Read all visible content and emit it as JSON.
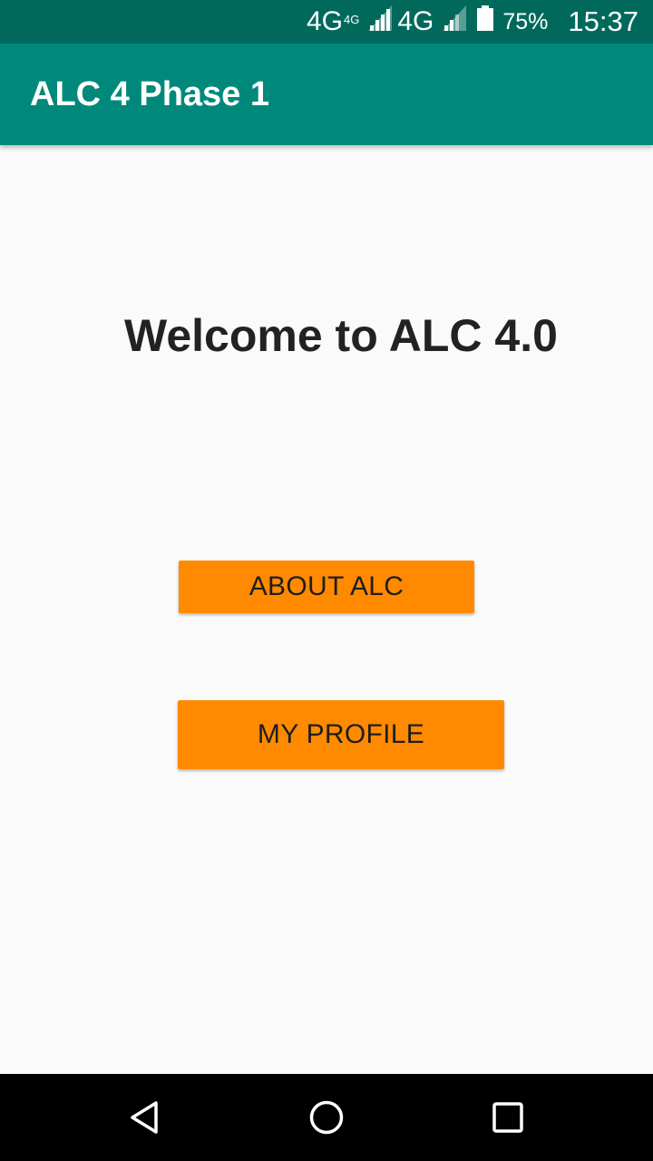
{
  "status_bar": {
    "network_1": "4G",
    "network_1_sup": "4G",
    "network_2": "4G",
    "battery_percent": "75%",
    "time": "15:37",
    "icons": [
      "signal-icon",
      "signal-icon",
      "battery-icon"
    ]
  },
  "app_bar": {
    "title": "ALC 4 Phase 1"
  },
  "main": {
    "welcome_text": "Welcome to ALC 4.0",
    "about_button_label": "ABOUT ALC",
    "profile_button_label": "MY PROFILE"
  },
  "nav_bar": {
    "icons": [
      "back-icon",
      "home-icon",
      "recents-icon"
    ]
  },
  "colors": {
    "status_bar": "#00695c",
    "app_bar": "#00897b",
    "button": "#ff8a00",
    "background": "#fafafa",
    "nav_bar": "#000000"
  }
}
